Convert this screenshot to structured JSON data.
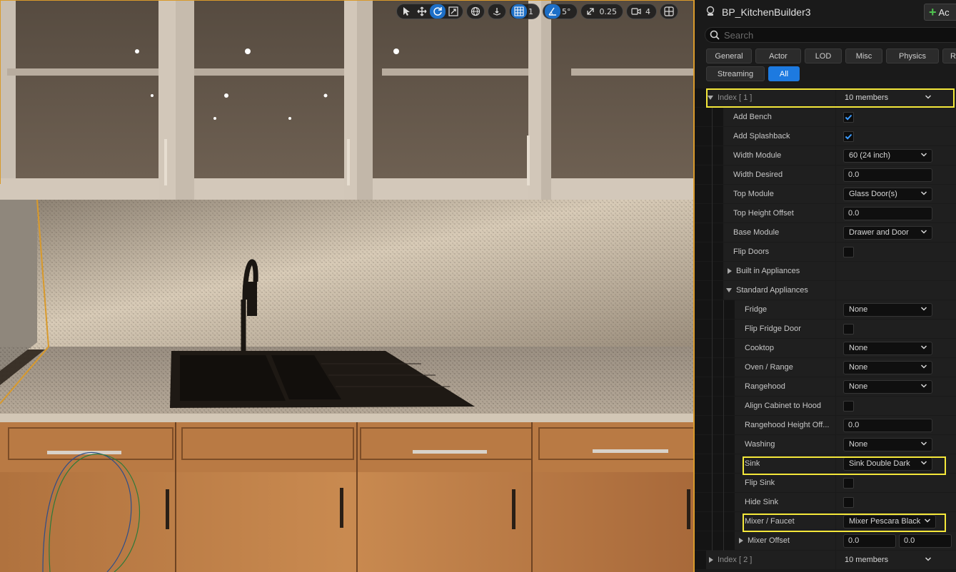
{
  "viewport": {
    "select_mode": "select-arrow-icon",
    "grid_snap_value": "1",
    "rotate_snap_value": "5°",
    "scale_snap_value": "0.25",
    "camera_speed_value": "4"
  },
  "details": {
    "title": "BP_KitchenBuilder3",
    "add_label": "Ac",
    "search_placeholder": "Search",
    "filter_tabs": [
      "General",
      "Actor",
      "LOD",
      "Misc",
      "Physics",
      "R",
      "Streaming",
      "All"
    ],
    "active_tab": "All",
    "index1": {
      "label": "Index [ 1 ]",
      "value": "10 members"
    },
    "index2": {
      "label": "Index [ 2 ]",
      "value": "10 members"
    },
    "props": {
      "add_bench": {
        "label": "Add Bench",
        "checked": true
      },
      "add_splashback": {
        "label": "Add Splashback",
        "checked": true
      },
      "width_module": {
        "label": "Width Module",
        "value": "60 (24 inch)"
      },
      "width_desired": {
        "label": "Width Desired",
        "value": "0.0"
      },
      "top_module": {
        "label": "Top Module",
        "value": "Glass Door(s)"
      },
      "top_height_offset": {
        "label": "Top Height Offset",
        "value": "0.0"
      },
      "base_module": {
        "label": "Base Module",
        "value": "Drawer and Door"
      },
      "flip_doors": {
        "label": "Flip Doors",
        "checked": false
      },
      "built_in_appliances": {
        "label": "Built in Appliances"
      },
      "standard_appliances": {
        "label": "Standard Appliances"
      },
      "fridge": {
        "label": "Fridge",
        "value": "None"
      },
      "flip_fridge_door": {
        "label": "Flip Fridge Door",
        "checked": false
      },
      "cooktop": {
        "label": "Cooktop",
        "value": "None"
      },
      "oven_range": {
        "label": "Oven / Range",
        "value": "None"
      },
      "rangehood": {
        "label": "Rangehood",
        "value": "None"
      },
      "align_cabinet_to_hood": {
        "label": "Align Cabinet to Hood",
        "checked": false
      },
      "rangehood_height_offset": {
        "label": "Rangehood Height Off...",
        "value": "0.0"
      },
      "washing": {
        "label": "Washing",
        "value": "None"
      },
      "sink": {
        "label": "Sink",
        "value": "Sink Double Dark"
      },
      "flip_sink": {
        "label": "Flip Sink",
        "checked": false
      },
      "hide_sink": {
        "label": "Hide Sink",
        "checked": false
      },
      "mixer_faucet": {
        "label": "Mixer / Faucet",
        "value": "Mixer Pescara Black"
      },
      "mixer_offset": {
        "label": "Mixer Offset",
        "x": "0.0",
        "y": "0.0"
      }
    }
  },
  "colors": {
    "accent": "#1d7ae0",
    "highlight": "#f5e83a",
    "selection_outline": "#d99a2b",
    "panel_bg": "#1a1a1a"
  }
}
